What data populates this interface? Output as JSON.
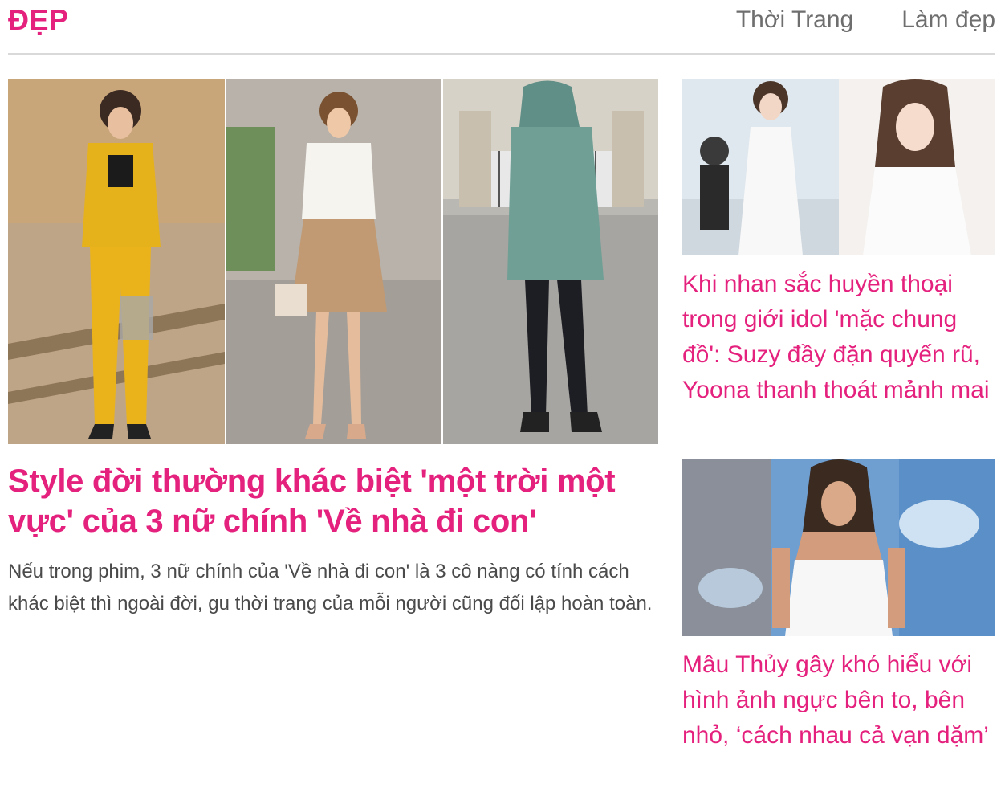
{
  "header": {
    "logo": "ĐẸP",
    "nav": [
      "Thời Trang",
      "Làm đẹp"
    ]
  },
  "featured": {
    "title": "Style đời thường khác biệt 'một trời một vực' của 3 nữ chính 'Về nhà đi con'",
    "description": "Nếu trong phim, 3 nữ chính của 'Về nhà đi con' là 3 cô nàng có tính cách khác biệt thì ngoài đời, gu thời trang của mỗi người cũng đối lập hoàn toàn."
  },
  "side_articles": [
    {
      "title": "Khi nhan sắc huyền thoại trong giới idol 'mặc chung đồ': Suzy đầy đặn quyến rũ, Yoona thanh thoát mảnh mai"
    },
    {
      "title": "Mâu Thủy gây khó hiểu với hình ảnh ngực bên to, bên nhỏ, ‘cách nhau cả vạn dặm’"
    }
  ],
  "colors": {
    "accent": "#e5217e",
    "nav_text": "#6e6e6e",
    "body_text": "#4a4a4a",
    "divider": "#d9d9d9"
  }
}
